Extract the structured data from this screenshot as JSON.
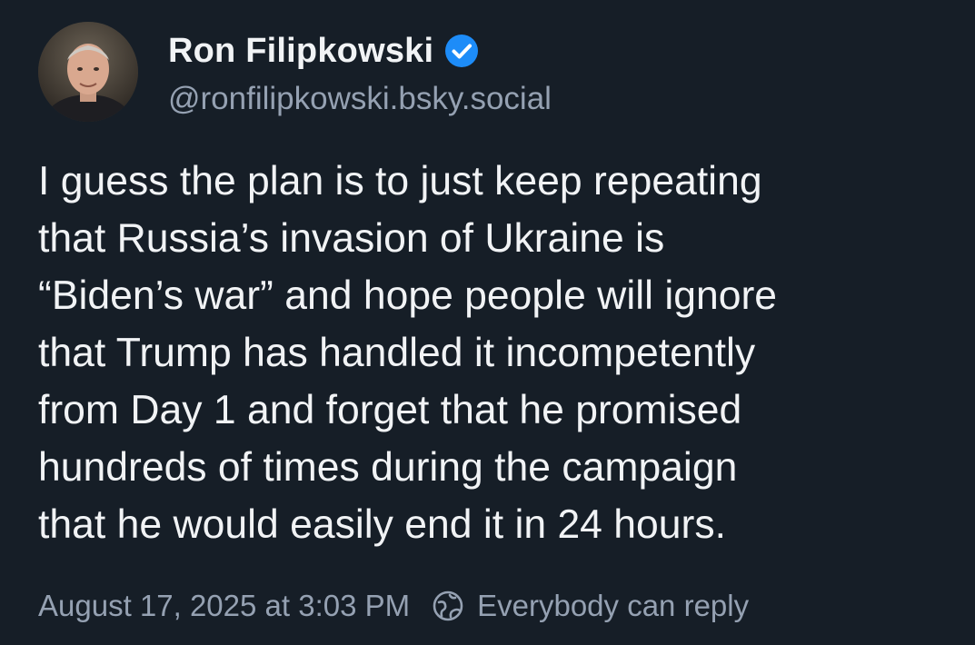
{
  "post": {
    "author": {
      "name": "Ron Filipkowski",
      "handle": "@ronfilipkowski.bsky.social",
      "verified": true,
      "verified_badge_icon": "verified-check-icon",
      "badge_color": "#1d8cf8"
    },
    "text": "I guess the plan is to just keep repeating\nthat Russia’s invasion of Ukraine is\n“Biden’s war” and hope people will ignore\nthat Trump has handled it incompetently\nfrom Day 1 and forget that he promised\nhundreds of times during the campaign\nthat he would easily end it in 24 hours.",
    "timestamp": "August 17, 2025 at 3:03 PM",
    "reply_setting": {
      "label": "Everybody can reply",
      "icon": "globe-icon"
    }
  },
  "theme": {
    "background": "#161e27",
    "text": "#f1f3f5",
    "muted_text": "#95a1b2"
  }
}
